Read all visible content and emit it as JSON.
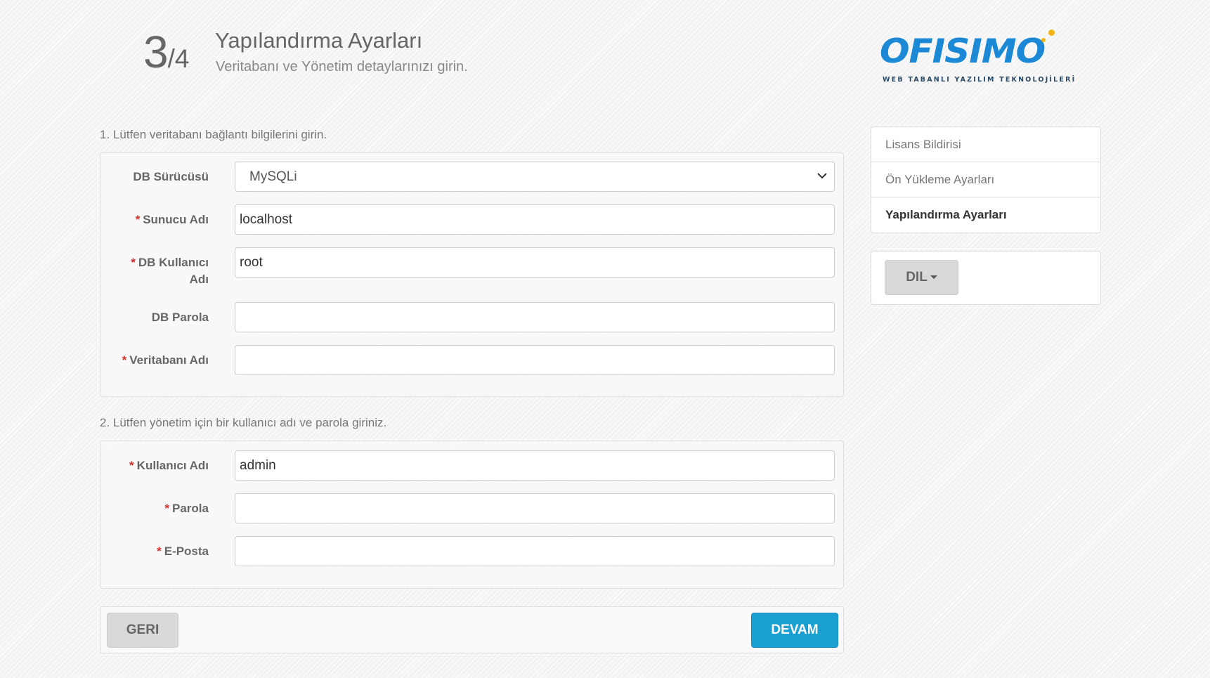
{
  "header": {
    "step_current": "3",
    "step_total": "/4",
    "title": "Yapılandırma Ayarları",
    "subtitle": "Veritabanı ve Yönetim detaylarınızı girin."
  },
  "logo": {
    "wordmark": "OFISIMO",
    "tagline": "WEB TABANLI YAZILIM TEKNOLOJİLERİ"
  },
  "section_db": {
    "label": "1. Lütfen veritabanı bağlantı bilgilerini girin.",
    "driver_label": "DB Sürücüsü",
    "driver_value": "MySQLi",
    "host_label": "Sunucu Adı",
    "host_value": "localhost",
    "user_label_line1": "DB Kullanıcı",
    "user_label_line2": "Adı",
    "user_value": "root",
    "password_label": "DB Parola",
    "password_value": "",
    "dbname_label": "Veritabanı Adı",
    "dbname_value": ""
  },
  "section_admin": {
    "label": "2. Lütfen yönetim için bir kullanıcı adı ve parola giriniz.",
    "username_label": "Kullanıcı Adı",
    "username_value": "admin",
    "password_label": "Parola",
    "password_value": "",
    "email_label": "E-Posta",
    "email_value": ""
  },
  "required_marker": "*",
  "sidebar": {
    "items": [
      {
        "label": "Lisans Bildirisi",
        "active": false
      },
      {
        "label": "Ön Yükleme Ayarları",
        "active": false
      },
      {
        "label": "Yapılandırma Ayarları",
        "active": true
      }
    ]
  },
  "language": {
    "button_label": "DIL"
  },
  "footer": {
    "back_label": "GERI",
    "next_label": "DEVAM"
  },
  "colors": {
    "primary": "#1a9fd3",
    "required": "#d9302c",
    "logo_blue": "#1c89d6",
    "logo_accent": "#f5b415"
  }
}
